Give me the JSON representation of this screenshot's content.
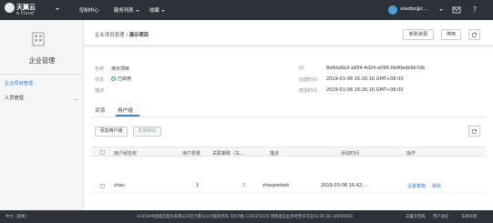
{
  "topbar": {
    "logo_text": "天翼云",
    "logo_sub": "e Cloud",
    "nav": [
      {
        "label": "控制中心"
      },
      {
        "label": "服务列表"
      },
      {
        "label": "收藏"
      }
    ],
    "user_name": "xiaobo@c..."
  },
  "sidebar": {
    "title": "企业管理",
    "items": [
      {
        "label": "企业项目管理",
        "active": true
      },
      {
        "label": "人员管理",
        "active": false
      }
    ]
  },
  "header": {
    "breadcrumb_parent": "企业项目管理",
    "breadcrumb_sep": "/",
    "breadcrumb_current": "演示项目",
    "buttons": {
      "migrate": "新购资源",
      "disable": "停用"
    }
  },
  "info": {
    "name_label": "名称",
    "name_value": "演示项目",
    "status_label": "状态",
    "status_value": "已启用",
    "desc_label": "描述",
    "desc_value": "",
    "id_label": "ID",
    "id_value": "8d4da6b3-a954-4d24-a096-0b90edb6b7db",
    "created_label": "创建时间",
    "created_value": "2019-03-08 16:26:16 GMT+08:00",
    "modified_label": "修改时间",
    "modified_value": "2019-03-08 16:26:16 GMT+08:00"
  },
  "tabs": [
    {
      "label": "资源",
      "active": false
    },
    {
      "label": "用户组",
      "active": true
    }
  ],
  "toolbar": {
    "add_group": "添加用户组",
    "batch_remove": "批量移除"
  },
  "table": {
    "columns": [
      "用户组名称",
      "用户数量",
      "关联策略（关...",
      "描述",
      "添加时间",
      "操作"
    ],
    "rows": [
      {
        "name": "zhan",
        "user_count": "1",
        "policies": "2",
        "desc": "zhanpeitest",
        "added": "2019-03-08 16:42:...",
        "action_set": "设置策略",
        "action_remove": "移除"
      }
    ]
  },
  "footer": {
    "lang": "中文（简体）",
    "copyright": "©2019中国电信股份有限公司云计算分公司版权所有 京ICP备 12022551号 增值电信业务经营许可证A2.B1.B2-20090001",
    "links": [
      "天翼云官网",
      "用户协议",
      "法律声明"
    ]
  }
}
